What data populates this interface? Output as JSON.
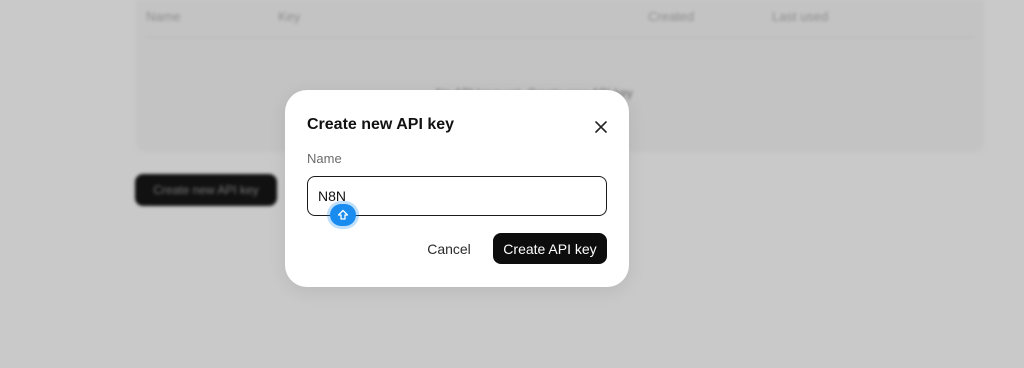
{
  "background": {
    "table_headers": [
      "Name",
      "Key",
      "Created",
      "Last used"
    ],
    "empty_text": "No API keys yet. Create new API key",
    "create_button_label": "Create new API key"
  },
  "modal": {
    "title": "Create new API key",
    "name_label": "Name",
    "name_value": "N8N",
    "cancel_label": "Cancel",
    "submit_label": "Create API key"
  },
  "icons": {
    "close": "close-icon",
    "cursor": "shift-arrow-icon"
  },
  "colors": {
    "primary_button": "#0d0d0d",
    "cursor_badge": "#1a8cf0",
    "overlay": "#c9c9c9"
  }
}
